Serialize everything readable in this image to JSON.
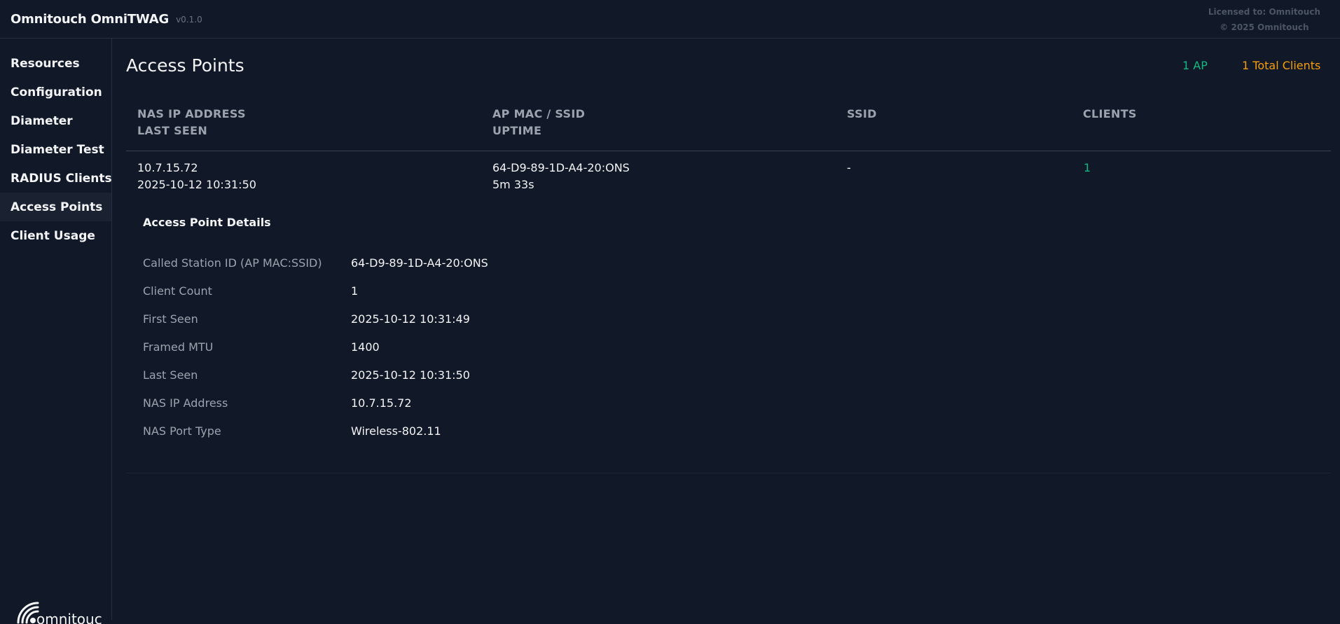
{
  "header": {
    "app_name": "Omnitouch OmniTWAG",
    "version": "v0.1.0",
    "license_line1": "Licensed to: Omnitouch",
    "license_line2": "© 2025 Omnitouch"
  },
  "sidebar": {
    "items": [
      {
        "label": "Resources"
      },
      {
        "label": "Configuration"
      },
      {
        "label": "Diameter"
      },
      {
        "label": "Diameter Test"
      },
      {
        "label": "RADIUS Clients"
      },
      {
        "label": "Access Points",
        "active": true
      },
      {
        "label": "Client Usage"
      }
    ],
    "logo_text": "omnitouch"
  },
  "main": {
    "title": "Access Points",
    "stats": {
      "ap_count": "1 AP",
      "total_clients": "1 Total Clients"
    },
    "columns": [
      {
        "line1": "NAS IP ADDRESS",
        "line2": "LAST SEEN"
      },
      {
        "line1": "AP MAC / SSID",
        "line2": "UPTIME"
      },
      {
        "line1": "SSID",
        "line2": ""
      },
      {
        "line1": "CLIENTS",
        "line2": ""
      }
    ],
    "rows": [
      {
        "nas_ip": "10.7.15.72",
        "last_seen": "2025-10-12 10:31:50",
        "ap_mac_ssid": "64-D9-89-1D-A4-20:ONS",
        "uptime": "5m 33s",
        "ssid": "-",
        "clients": "1",
        "details": {
          "title": "Access Point Details",
          "fields": [
            {
              "label": "Called Station ID (AP MAC:SSID)",
              "value": "64-D9-89-1D-A4-20:ONS"
            },
            {
              "label": "Client Count",
              "value": "1"
            },
            {
              "label": "First Seen",
              "value": "2025-10-12 10:31:49"
            },
            {
              "label": "Framed MTU",
              "value": "1400"
            },
            {
              "label": "Last Seen",
              "value": "2025-10-12 10:31:50"
            },
            {
              "label": "NAS IP Address",
              "value": "10.7.15.72"
            },
            {
              "label": "NAS Port Type",
              "value": "Wireless-802.11"
            }
          ]
        }
      }
    ]
  },
  "colors": {
    "background": "#111827",
    "accent_green": "#10b981",
    "accent_amber": "#f59e0b",
    "muted": "#9ca3af"
  }
}
